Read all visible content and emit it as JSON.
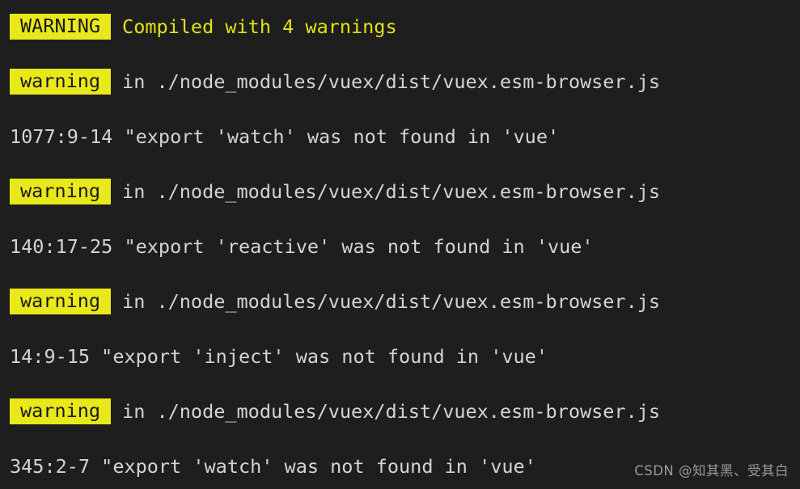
{
  "terminal": {
    "background_color": "#1e1e1e",
    "badge_background_color": "#e8e81a",
    "badge_text_color": "#1a1a1a",
    "headline_text_color": "#e2e21c",
    "body_text_color": "#d4d4d4",
    "watermark_color": "#9a9a9a"
  },
  "header": {
    "badge_label": "WARNING",
    "message": "Compiled with 4 warnings"
  },
  "warnings": [
    {
      "badge_label": "warning",
      "location": "in ./node_modules/vuex/dist/vuex.esm-browser.js",
      "detail": "1077:9-14 \"export 'watch' was not found in 'vue'"
    },
    {
      "badge_label": "warning",
      "location": "in ./node_modules/vuex/dist/vuex.esm-browser.js",
      "detail": "140:17-25 \"export 'reactive' was not found in 'vue'"
    },
    {
      "badge_label": "warning",
      "location": "in ./node_modules/vuex/dist/vuex.esm-browser.js",
      "detail": "14:9-15 \"export 'inject' was not found in 'vue'"
    },
    {
      "badge_label": "warning",
      "location": "in ./node_modules/vuex/dist/vuex.esm-browser.js",
      "detail": "345:2-7 \"export 'watch' was not found in 'vue'"
    }
  ],
  "watermark": {
    "text": "CSDN @知其黑、受其白"
  }
}
